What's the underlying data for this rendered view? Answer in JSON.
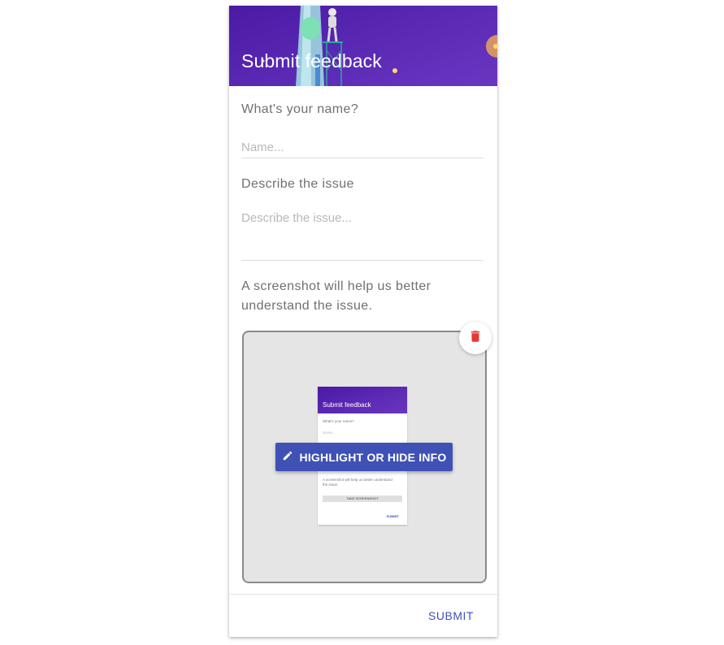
{
  "header": {
    "title": "Submit feedback"
  },
  "form": {
    "name_label": "What's your name?",
    "name_placeholder": "Name...",
    "name_value": "",
    "issue_label": "Describe the issue",
    "issue_placeholder": "Describe the issue...",
    "issue_value": "",
    "screenshot_text": "A screenshot will help us better understand the issue."
  },
  "screenshot": {
    "highlight_label": "HIGHLIGHT OR HIDE INFO",
    "delete_icon": "trash-icon",
    "highlight_icon": "pencil-icon",
    "preview": {
      "title": "Submit feedback",
      "name_label": "What's your name?",
      "name_placeholder": "Name...",
      "screenshot_text": "A screenshot will help us better understand the issue.",
      "take_screenshot_label": "TAKE SCREENSHOT",
      "submit_label": "SUBMIT"
    }
  },
  "footer": {
    "submit_label": "SUBMIT"
  },
  "colors": {
    "header": "#4a1aa4",
    "accent": "#3f51b5",
    "delete": "#e53935",
    "screenshot_bg": "#e5e5e5"
  }
}
